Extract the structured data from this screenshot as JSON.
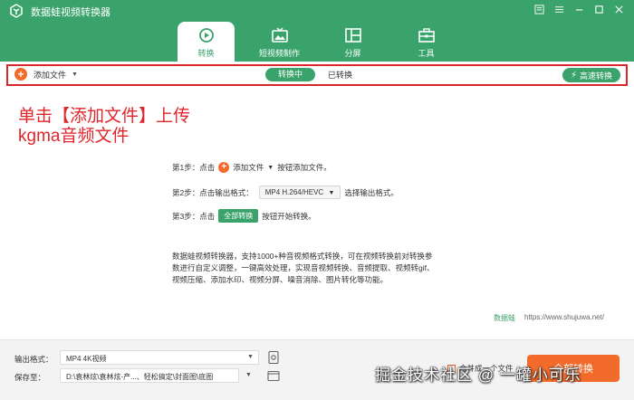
{
  "app": {
    "title": "数据蛙视频转换器"
  },
  "window_controls": [
    "menu-icon",
    "message-icon",
    "minimize-icon",
    "maximize-icon",
    "close-icon"
  ],
  "tabs": [
    {
      "label": "转换",
      "icon": "convert-icon",
      "active": true
    },
    {
      "label": "短视频制作",
      "icon": "tv-icon",
      "active": false
    },
    {
      "label": "分屏",
      "icon": "split-screen-icon",
      "active": false
    },
    {
      "label": "工具",
      "icon": "toolbox-icon",
      "active": false
    }
  ],
  "toolbar": {
    "add_file_label": "添加文件",
    "seg_converting": "转换中",
    "seg_converted": "已转换",
    "fast_convert": "高速转换"
  },
  "annotation": {
    "line1": "单击【添加文件】上传",
    "line2": "kgma音频文件"
  },
  "steps": {
    "s1_prefix": "第1步：点击",
    "s1_btn": "添加文件",
    "s1_suffix": "按钮添加文件。",
    "s2_prefix": "第2步：点击输出格式：",
    "s2_format": "MP4 H.264/HEVC",
    "s2_suffix": "选择输出格式。",
    "s3_prefix": "第3步：点击",
    "s3_btn": "全部转换",
    "s3_suffix": "按钮开始转换。"
  },
  "description": {
    "line1": "数据蛙视频转换器，支持1000+种音视频格式转换，可在视频转换前对转换参",
    "line2": "数进行自定义调整，一键高效处理，实现音视频转换、音频提取、视频转gif、",
    "line3": "视频压缩、添加水印、视频分屏、噪音消除、图片转化等功能。"
  },
  "brand": {
    "name": "数据蛙",
    "url": "https://www.shujuwa.net/"
  },
  "bottom": {
    "output_label": "输出格式：",
    "output_value": "MP4 4K视频",
    "save_label": "保存至：",
    "save_value": "D:\\袁林炫\\袁林炫-产...、轻松搞定\\封面图\\底图",
    "merge_label": "合并成一个文件",
    "convert_all": "全部转换"
  },
  "watermark": "掘金技术社区 @ 一罐小可乐",
  "colors": {
    "brand_green": "#3aa36b",
    "accent_orange": "#f36b2b",
    "annotation_red": "#e0262b"
  }
}
